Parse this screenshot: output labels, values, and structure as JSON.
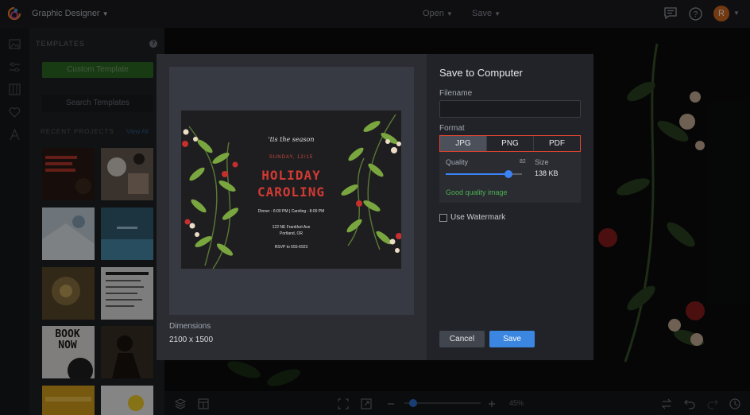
{
  "app": {
    "title": "Graphic Designer"
  },
  "topbar": {
    "open_label": "Open",
    "save_label": "Save",
    "avatar_letter": "R"
  },
  "templates": {
    "header": "TEMPLATES",
    "help_label": "?",
    "custom_button": "Custom Template",
    "search_button": "Search Templates",
    "recent_header": "RECENT PROJECTS",
    "view_all": "View All"
  },
  "thumbs": [
    {
      "text": ""
    },
    {
      "text": ""
    },
    {
      "text": ""
    },
    {
      "text": ""
    },
    {
      "text": ""
    },
    {
      "text": ""
    },
    {
      "text": "BOOK NOW"
    },
    {
      "text": ""
    }
  ],
  "zoom": {
    "value": "45%"
  },
  "modal": {
    "title": "Save to Computer",
    "filename_label": "Filename",
    "filename_value": "",
    "format_label": "Format",
    "formats": [
      "JPG",
      "PNG",
      "PDF"
    ],
    "active_format": "JPG",
    "quality_label": "Quality",
    "quality_value": 82,
    "size_label": "Size",
    "size_value": "138 KB",
    "quality_note": "Good quality image",
    "watermark_label": "Use Watermark",
    "watermark_checked": false,
    "dimensions_label": "Dimensions",
    "dimensions_value": "2100 x 1500",
    "cancel_label": "Cancel",
    "save_label": "Save"
  },
  "card": {
    "tagline": "'tis the season",
    "date": "SUNDAY, 12/15",
    "title_line1": "HOLIDAY",
    "title_line2": "CAROLING",
    "schedule": "Dinner - 6:00 PM | Caroling - 8:00 PM",
    "address_line1": "122 NE Frankfurt Ave",
    "address_line2": "Portland, OR",
    "rsvp": "RSVP to 555-6923"
  },
  "colors": {
    "accent_blue": "#3a86e0",
    "format_border": "#e0452f",
    "good_quality": "#4caf50",
    "custom_button": "#2f6c25",
    "holiday_red": "#d23a34"
  }
}
